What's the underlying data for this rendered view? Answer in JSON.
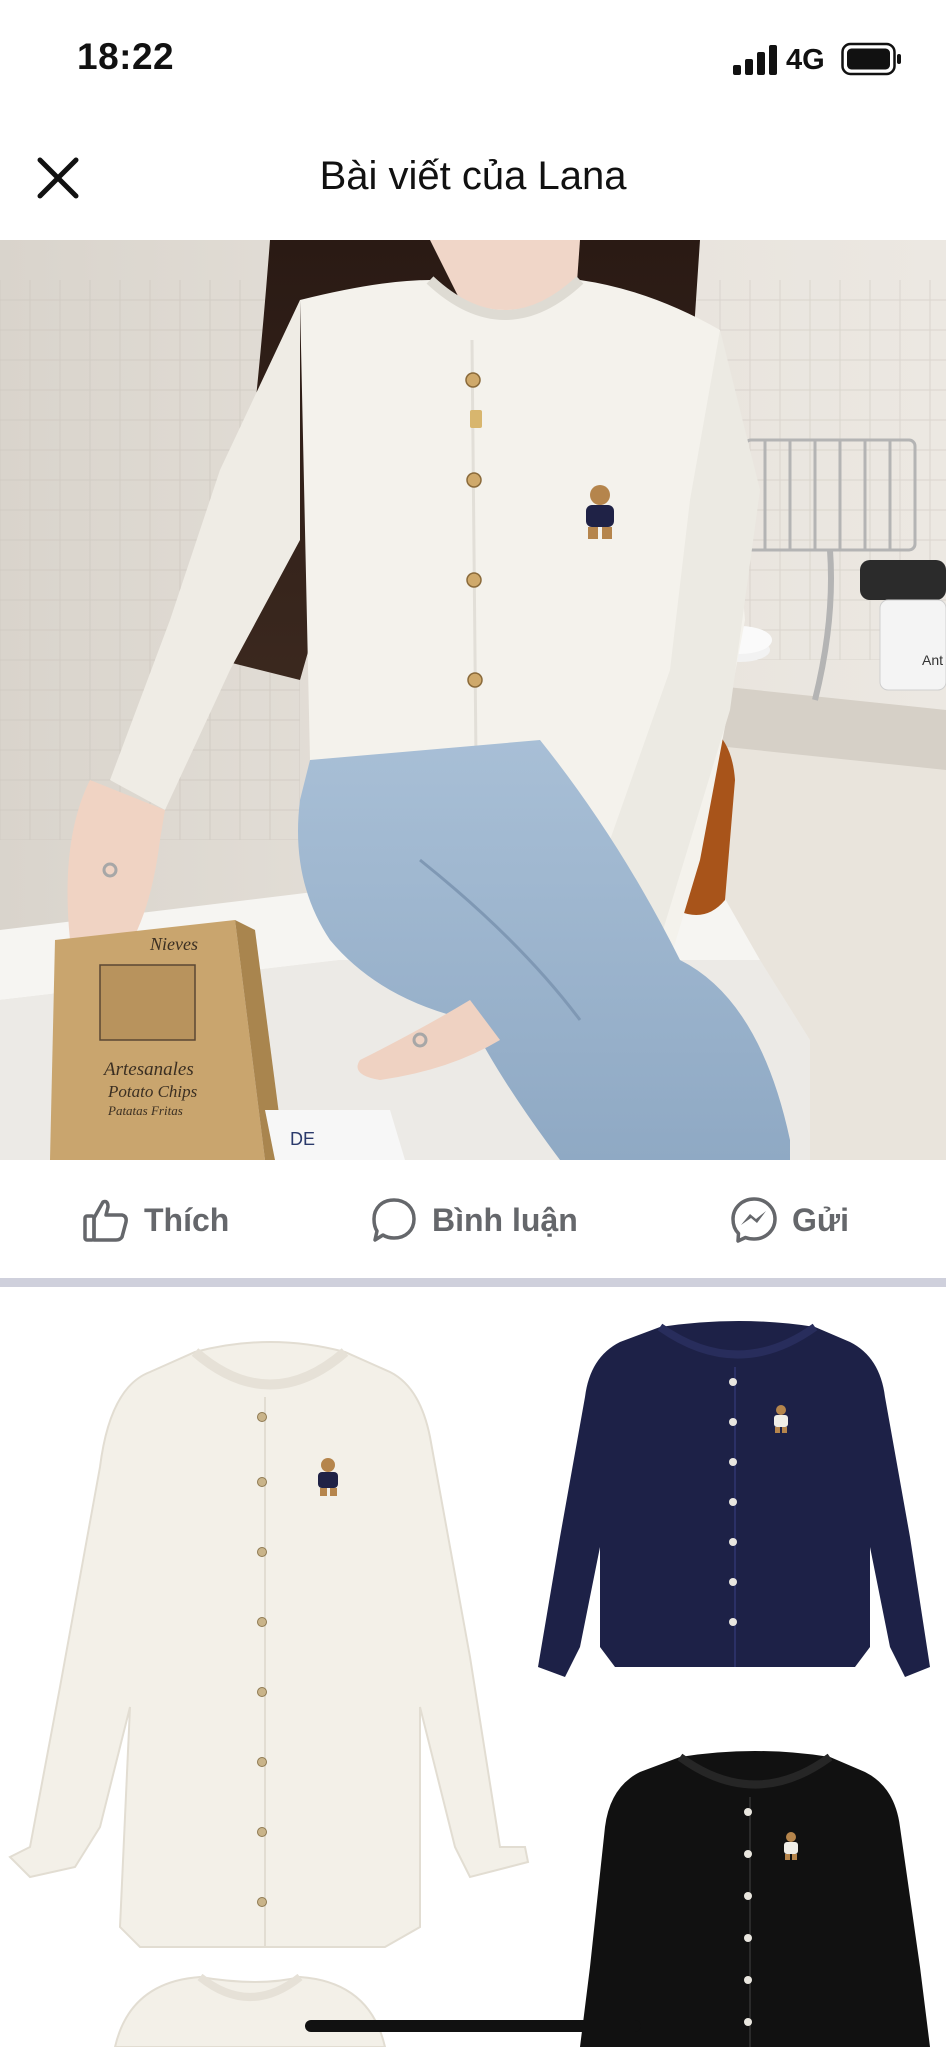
{
  "status_bar": {
    "time": "18:22",
    "network": "4G",
    "icons": [
      "signal-icon",
      "battery-icon"
    ]
  },
  "header": {
    "title": "Bài viết của Lana",
    "close_icon": "close-icon"
  },
  "hero_photo": {
    "bag_text": [
      "Nieves",
      "Artesanales",
      "Potato Chips",
      "Patatas Fritas"
    ],
    "box_text": "DE",
    "appliance_text": "Ant"
  },
  "actions": {
    "like": {
      "label": "Thích",
      "icon": "thumbs-up-icon"
    },
    "comment": {
      "label": "Bình luận",
      "icon": "comment-bubble-icon"
    },
    "share": {
      "label": "Gửi",
      "icon": "messenger-icon"
    }
  },
  "colors": {
    "action_text": "#65676b",
    "divider": "#cfd0dc",
    "cardigan_white": "#f3f0e8",
    "cardigan_navy": "#1d2147",
    "cardigan_black": "#111111"
  }
}
